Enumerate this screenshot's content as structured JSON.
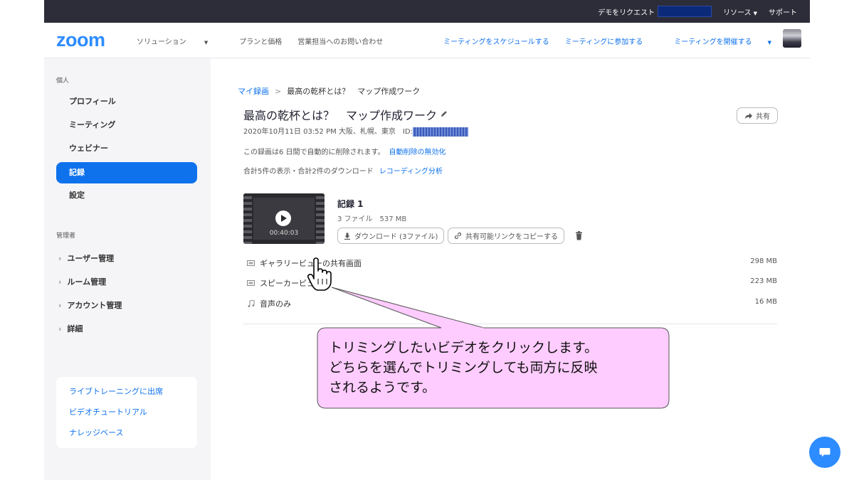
{
  "topbar": {
    "request_demo": "デモをリクエスト",
    "resources": "リソース",
    "support": "サポート"
  },
  "nav": {
    "logo": "zoom",
    "solutions": "ソリューション",
    "plans": "プランと価格",
    "contact_sales": "営業担当へのお問い合わせ",
    "schedule": "ミーティングをスケジュールする",
    "join": "ミーティングに参加する",
    "host": "ミーティングを開催する"
  },
  "sidebar": {
    "personal_title": "個人",
    "items": [
      "プロフィール",
      "ミーティング",
      "ウェビナー",
      "記録",
      "設定"
    ],
    "admin_title": "管理者",
    "admin_items": [
      "ユーザー管理",
      "ルーム管理",
      "アカウント管理",
      "詳細"
    ],
    "help": [
      "ライブトレーニングに出席",
      "ビデオチュートリアル",
      "ナレッジベース"
    ]
  },
  "breadcrumb": {
    "root": "マイ録画",
    "sep": ">",
    "current": "最高の乾杯とは？　マップ作成ワーク"
  },
  "recording": {
    "title": "最高の乾杯とは？　マップ作成ワーク",
    "meta": "2020年10月11日 03:52 PM 大阪、札幌、東京　ID:",
    "auto_delete_text": "この録画は6 日間で自動的に削除されます。",
    "auto_delete_link": "自動削除の無効化",
    "stats_text": "合計5件の表示・合計2件のダウンロード",
    "stats_link": "レコーディング分析",
    "share": "共有",
    "duration": "00:40:03",
    "rec_title": "記録 1",
    "rec_info": "3 ファイル　537 MB",
    "download": "ダウンロード (3ファイル)",
    "copy_link": "共有可能リンクをコピーする"
  },
  "files": [
    {
      "name": "ギャラリービューの共有画面",
      "size": "298 MB",
      "icon": "video-icon"
    },
    {
      "name": "スピーカービュー",
      "size": "223 MB",
      "icon": "video-icon"
    },
    {
      "name": "音声のみ",
      "size": "16 MB",
      "icon": "music-note-icon"
    }
  ],
  "callout": {
    "line1": "トリミングしたいビデオをクリックします。",
    "line2": "どちらを選んでトリミングしても両方に反映",
    "line3": "されるようです。"
  },
  "colors": {
    "accent": "#0e72ed",
    "topbar": "#2d2d3a",
    "callout_fill": "#ffccff"
  }
}
